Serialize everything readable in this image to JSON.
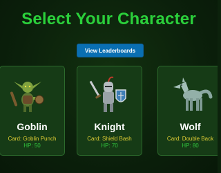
{
  "header": {
    "title": "Select Your Character",
    "leaderboard_button": "View Leaderboards"
  },
  "characters": [
    {
      "name": "Goblin",
      "card": "Card: Goblin Punch",
      "hp": "HP: 50",
      "icon": "goblin-icon"
    },
    {
      "name": "Knight",
      "card": "Card: Shield Bash",
      "hp": "HP: 70",
      "icon": "knight-icon"
    },
    {
      "name": "Wolf",
      "card": "Card: Double Back",
      "hp": "HP: 80",
      "icon": "wolf-icon"
    }
  ]
}
